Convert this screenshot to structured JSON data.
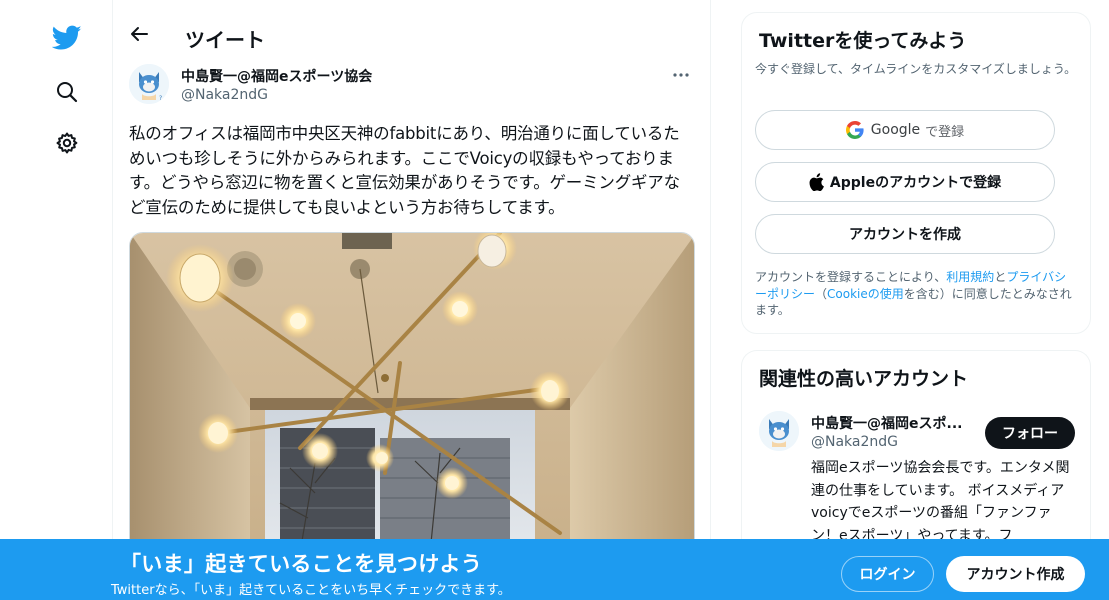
{
  "nav": {
    "items": [
      {
        "icon": "twitter-bird-icon"
      },
      {
        "icon": "search-icon"
      },
      {
        "icon": "gear-icon"
      }
    ],
    "brand_color": "#1d9bf0"
  },
  "header": {
    "back_icon": "arrow-left-icon",
    "title": "ツイート"
  },
  "tweet": {
    "author_name": "中島賢一@福岡eスポーツ協会",
    "author_handle": "@Naka2ndG",
    "more_icon": "more-horizontal-icon",
    "text": "私のオフィスは福岡市中央区天神のfabbitにあり、明治通りに面しているためいつも珍しそうに外からみられます。ここでVoicyの収録もやっております。どうやら窓辺に物を置くと宣伝効果がありそうです。ゲーミングギアなど宣伝のために提供しても良いよという方お待ちしてます。",
    "media_icon": "photo-office-chandelier"
  },
  "signup_card": {
    "title": "Twitterを使ってみよう",
    "subtitle": "今すぐ登録して、タイムラインをカスタマイズしましょう。",
    "google_label": "Google",
    "google_suffix": "で登録",
    "apple_label": "Appleのアカウントで登録",
    "create_label": "アカウントを作成",
    "terms_prefix": "アカウントを登録することにより、",
    "terms_link": "利用規約",
    "terms_and": "と",
    "privacy_link": "プライバシーポリシー",
    "cookie_open": "（",
    "cookie_link": "Cookieの使用",
    "cookie_close": "を含む）に同意したとみなされます。"
  },
  "related_card": {
    "title": "関連性の高いアカウント",
    "name": "中島賢一@福岡eスポ...",
    "handle": "@Naka2ndG",
    "follow_label": "フォロー",
    "bio": "福岡eスポーツ協会会長です。エンタメ関連の仕事をしています。 ボイスメディアvoicyでeスポーツの番組「ファンファン！eスポーツ」やってます。フ"
  },
  "banner": {
    "title": "「いま」起きていることを見つけよう",
    "subtitle": "Twitterなら、「いま」起きていることをいち早くチェックできます。",
    "login_label": "ログイン",
    "signup_label": "アカウント作成",
    "color": "#1d9bf0"
  }
}
